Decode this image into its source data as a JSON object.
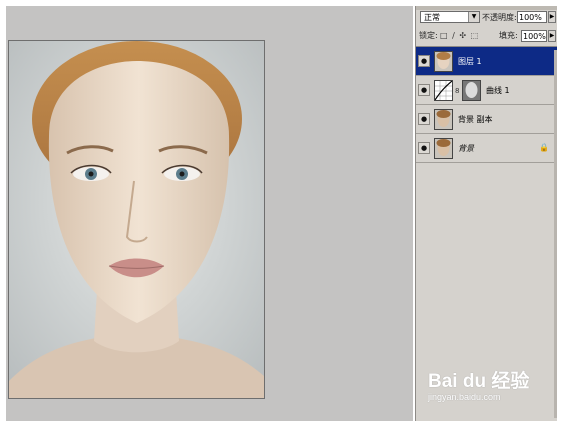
{
  "layers_panel": {
    "blend_mode": "正常",
    "opacity_label": "不透明度:",
    "opacity_value": "100%",
    "lock_label": "锁定:",
    "lock_icons": "□ ∕ ✣ ⬚",
    "fill_label": "填充:",
    "fill_value": "100%",
    "layers": [
      {
        "name": "图层 1",
        "selected": true,
        "icon": "face-thumbnail"
      },
      {
        "name": "曲线 1",
        "selected": false,
        "icon": "curves-adjustment-thumbnail"
      },
      {
        "name": "背景 副本",
        "selected": false,
        "icon": "face-thumbnail"
      },
      {
        "name": "背景",
        "selected": false,
        "icon": "face-thumbnail",
        "locked": true
      }
    ]
  },
  "watermark": {
    "logo_text": "Bai du 经验",
    "url": "jingyan.baidu.com"
  },
  "colors": {
    "canvas_bg": "#c4c3c2",
    "panel_bg": "#d5d2cd",
    "selected_layer": "#0d2a86"
  }
}
